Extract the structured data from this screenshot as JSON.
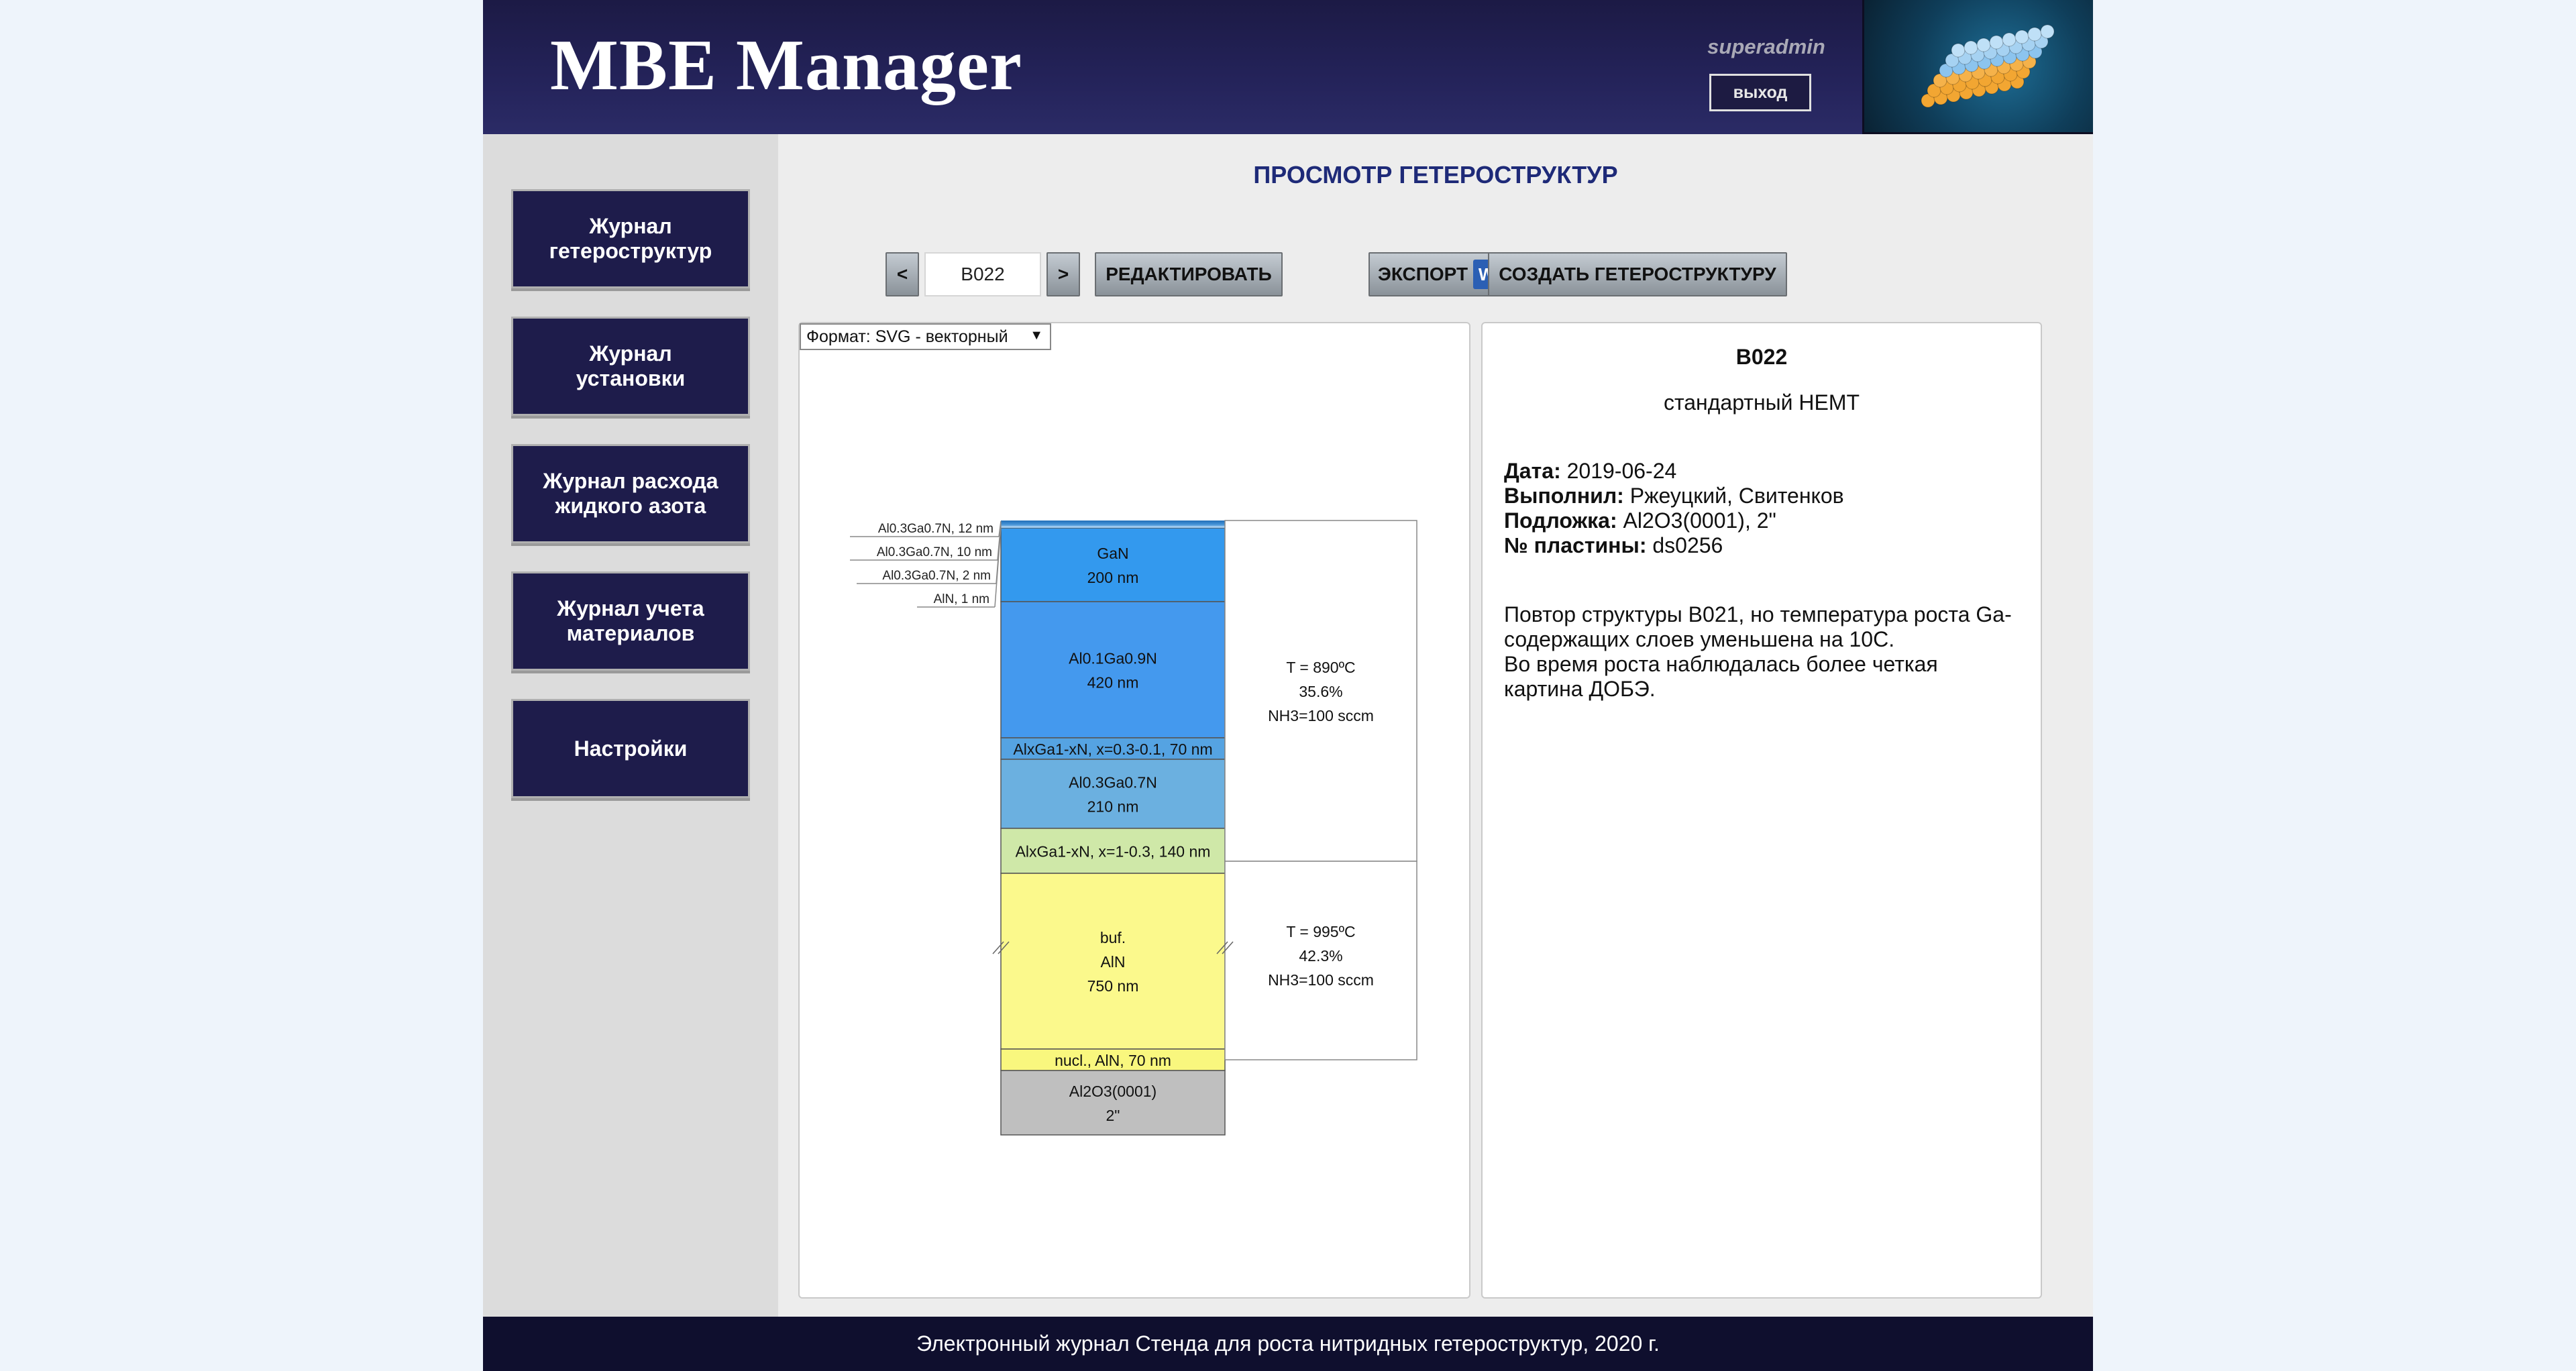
{
  "header": {
    "app_title": "MBE Manager",
    "user": "superadmin",
    "logout_label": "выход"
  },
  "sidebar": {
    "items": [
      {
        "label": "Журнал\nгетероструктур"
      },
      {
        "label": "Журнал\nустановки"
      },
      {
        "label": "Журнал расхода\nжидкого азота"
      },
      {
        "label": "Журнал учета\nматериалов"
      },
      {
        "label": "Настройки"
      }
    ]
  },
  "main": {
    "page_title": "ПРОСМОТР ГЕТЕРОСТРУКТУР",
    "prev_label": "<",
    "next_label": ">",
    "structure_code": "B022",
    "edit_label": "РЕДАКТИРОВАТЬ",
    "export_label": "ЭКСПОРТ",
    "export_icon": "W",
    "create_label": "СОЗДАТЬ ГЕТЕРОСТРУКТУРУ",
    "format_select": "Формат: SVG - векторный",
    "format_arrow": "▼"
  },
  "diagram": {
    "thin_layers": [
      {
        "label": "Al0.3Ga0.7N, 12 nm"
      },
      {
        "label": "Al0.3Ga0.7N, 10 nm"
      },
      {
        "label": "Al0.3Ga0.7N, 2 nm"
      },
      {
        "label": "AlN, 1 nm"
      }
    ],
    "layers": [
      {
        "lines": [
          "GaN",
          "200 nm"
        ],
        "color": "#3399ee"
      },
      {
        "lines": [
          "Al0.1Ga0.9N",
          "420 nm"
        ],
        "color": "#4499ee"
      },
      {
        "lines": [
          "AlxGa1-xN, x=0.3-0.1, 70 nm"
        ],
        "color": "#55a3e2"
      },
      {
        "lines": [
          "Al0.3Ga0.7N",
          "210 nm"
        ],
        "color": "#6bb0e0"
      },
      {
        "lines": [
          "AlxGa1-xN, x=1-0.3, 140 nm"
        ],
        "color": "#cfe8a8"
      },
      {
        "lines": [
          "buf.",
          "AlN",
          "750 nm"
        ],
        "color": "#fbf98c"
      },
      {
        "lines": [
          "nucl., AlN, 70 nm"
        ],
        "color": "#f9f77e"
      },
      {
        "lines": [
          "Al2O3(0001)",
          "2\""
        ],
        "color": "#bfbfbf"
      }
    ],
    "conditions": [
      {
        "lines": [
          "T = 890ºC",
          "35.6%",
          "NH3=100 sccm"
        ]
      },
      {
        "lines": [
          "T = 995ºC",
          "42.3%",
          "NH3=100 sccm"
        ]
      }
    ]
  },
  "info": {
    "code": "B022",
    "description": "стандартный HEMT",
    "date_label": "Дата:",
    "date_value": "2019-06-24",
    "performer_label": "Выполнил:",
    "performer_value": "Ржеуцкий, Свитенков",
    "substrate_label": "Подложка:",
    "substrate_value": "Al2O3(0001), 2\"",
    "wafer_label": "№ пластины:",
    "wafer_value": "ds0256",
    "notes": "Повтор структуры B021, но температура роста Ga-\nсодержащих слоев уменьшена на 10С.\nВо время роста наблюдалась более четкая\nкартина ДОБЭ."
  },
  "footer": {
    "text": "Электронный журнал Стенда для роста нитридных гетероструктур, 2020 г."
  }
}
